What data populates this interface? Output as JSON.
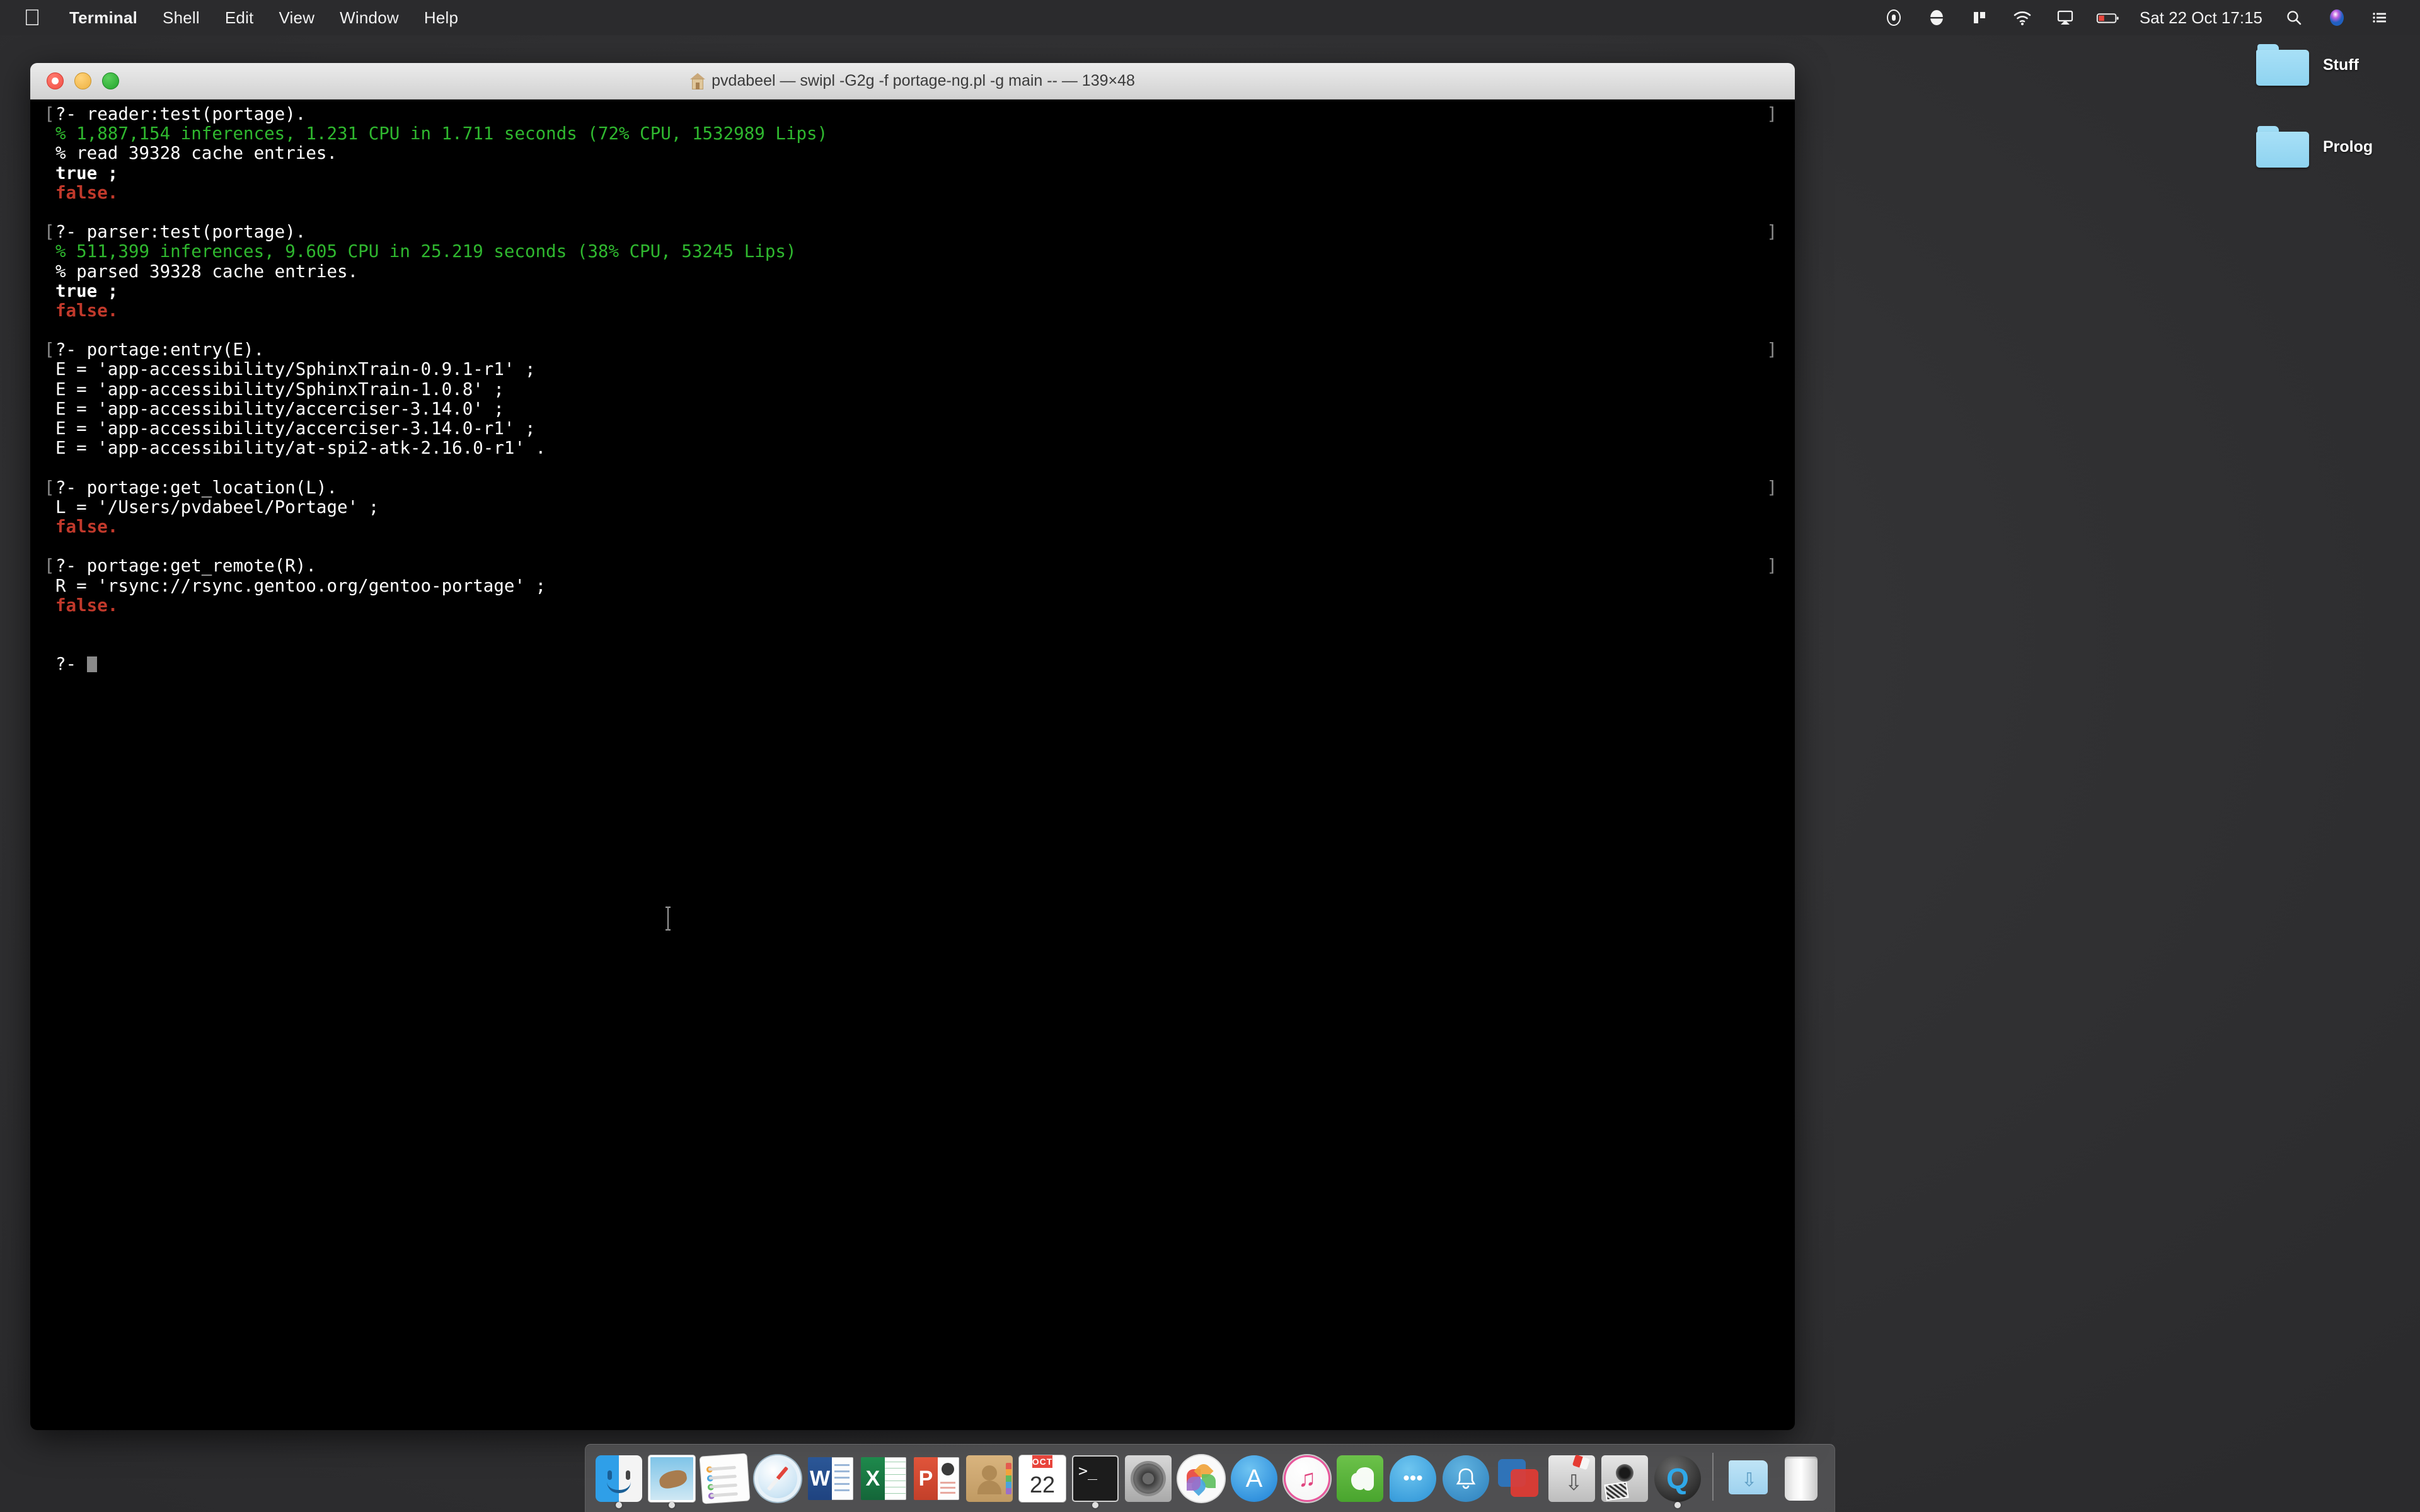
{
  "menubar": {
    "apple_icon": "apple-logo",
    "items": [
      {
        "label": "Terminal",
        "bold": true
      },
      {
        "label": "Shell",
        "bold": false
      },
      {
        "label": "Edit",
        "bold": false
      },
      {
        "label": "View",
        "bold": false
      },
      {
        "label": "Window",
        "bold": false
      },
      {
        "label": "Help",
        "bold": false
      }
    ],
    "status_icons": [
      "screen-recording-icon",
      "display-contrast-icon",
      "split-view-icon",
      "wifi-icon",
      "airplay-icon",
      "battery-low-icon"
    ],
    "clock": "Sat 22 Oct  17:15",
    "search_icon": "search-icon",
    "siri_icon": "siri-icon",
    "control_center_icon": "control-center-icon",
    "battery_color": "#e8453c"
  },
  "desktop": {
    "background_color": "#313133",
    "icons": [
      {
        "name": "Stuff",
        "type": "folder"
      },
      {
        "name": "Prolog",
        "type": "folder"
      }
    ],
    "folder_color": "#8ed3f0"
  },
  "window": {
    "title": "pvdabeel — swipl -G2g -f portage-ng.pl -g main -- — 139×48",
    "home_icon": "home-folder-icon",
    "controls": {
      "close": "close-button",
      "minimize": "minimize-button",
      "zoom": "zoom-button"
    },
    "size_label": "139×48",
    "background_color": "#000000"
  },
  "terminal": {
    "prompt_mark_left": "[",
    "prompt_mark_right": "]",
    "colors": {
      "foreground": "#ffffff",
      "green": "#2fb82f",
      "red": "#c0392b",
      "cursor": "#8a8a8a",
      "mark": "#8a8a8a"
    },
    "lines": [
      {
        "text": "?- reader:test(portage).",
        "style": "white",
        "mark": true
      },
      {
        "text": "% 1,887,154 inferences, 1.231 CPU in 1.711 seconds (72% CPU, 1532989 Lips)",
        "style": "green",
        "mark": false
      },
      {
        "text": "% read 39328 cache entries.",
        "style": "white",
        "mark": false
      },
      {
        "text": "true ;",
        "style": "bold",
        "mark": false
      },
      {
        "text": "false.",
        "style": "red",
        "mark": false
      },
      {
        "text": "",
        "style": "white",
        "mark": false
      },
      {
        "text": "?- parser:test(portage).",
        "style": "white",
        "mark": true
      },
      {
        "text": "% 511,399 inferences, 9.605 CPU in 25.219 seconds (38% CPU, 53245 Lips)",
        "style": "green",
        "mark": false
      },
      {
        "text": "% parsed 39328 cache entries.",
        "style": "white",
        "mark": false
      },
      {
        "text": "true ;",
        "style": "bold",
        "mark": false
      },
      {
        "text": "false.",
        "style": "red",
        "mark": false
      },
      {
        "text": "",
        "style": "white",
        "mark": false
      },
      {
        "text": "?- portage:entry(E).",
        "style": "white",
        "mark": true
      },
      {
        "text": "E = 'app-accessibility/SphinxTrain-0.9.1-r1' ;",
        "style": "white",
        "mark": false
      },
      {
        "text": "E = 'app-accessibility/SphinxTrain-1.0.8' ;",
        "style": "white",
        "mark": false
      },
      {
        "text": "E = 'app-accessibility/accerciser-3.14.0' ;",
        "style": "white",
        "mark": false
      },
      {
        "text": "E = 'app-accessibility/accerciser-3.14.0-r1' ;",
        "style": "white",
        "mark": false
      },
      {
        "text": "E = 'app-accessibility/at-spi2-atk-2.16.0-r1' .",
        "style": "white",
        "mark": false
      },
      {
        "text": "",
        "style": "white",
        "mark": false
      },
      {
        "text": "?- portage:get_location(L).",
        "style": "white",
        "mark": true
      },
      {
        "text": "L = '/Users/pvdabeel/Portage' ;",
        "style": "white",
        "mark": false
      },
      {
        "text": "false.",
        "style": "red",
        "mark": false
      },
      {
        "text": "",
        "style": "white",
        "mark": false
      },
      {
        "text": "?- portage:get_remote(R).",
        "style": "white",
        "mark": true
      },
      {
        "text": "R = 'rsync://rsync.gentoo.org/gentoo-portage' ;",
        "style": "white",
        "mark": false
      },
      {
        "text": "false.",
        "style": "red",
        "mark": false
      },
      {
        "text": "",
        "style": "white",
        "mark": false
      },
      {
        "text": "",
        "style": "white",
        "mark": false
      }
    ],
    "active_prompt": "?- ",
    "mouse_cursor": "i-beam-cursor"
  },
  "dock": {
    "items": [
      {
        "name": "Finder",
        "icon": "finder-icon",
        "running": true
      },
      {
        "name": "Mail",
        "icon": "mail-icon",
        "running": true
      },
      {
        "name": "Notes",
        "icon": "notes-icon",
        "running": false
      },
      {
        "name": "Safari",
        "icon": "safari-icon",
        "running": false
      },
      {
        "name": "Microsoft Word",
        "icon": "word-icon",
        "running": false,
        "glyph": "W"
      },
      {
        "name": "Microsoft Excel",
        "icon": "excel-icon",
        "running": false,
        "glyph": "X"
      },
      {
        "name": "Microsoft PowerPoint",
        "icon": "powerpoint-icon",
        "running": false,
        "glyph": "P"
      },
      {
        "name": "Contacts",
        "icon": "contacts-icon",
        "running": false
      },
      {
        "name": "Calendar",
        "icon": "calendar-icon",
        "running": false,
        "month": "OCT",
        "day": "22"
      },
      {
        "name": "Terminal",
        "icon": "terminal-icon",
        "running": true,
        "glyph": ">_"
      },
      {
        "name": "System Preferences",
        "icon": "system-preferences-icon",
        "running": false
      },
      {
        "name": "Photos",
        "icon": "photos-icon",
        "running": false
      },
      {
        "name": "App Store",
        "icon": "app-store-icon",
        "running": false,
        "glyph": "A"
      },
      {
        "name": "iTunes",
        "icon": "itunes-icon",
        "running": false,
        "glyph": "♫"
      },
      {
        "name": "Evernote",
        "icon": "evernote-icon",
        "running": false,
        "glyph": "🐘"
      },
      {
        "name": "Messages",
        "icon": "messages-icon",
        "running": false,
        "glyph": "•••"
      },
      {
        "name": "Notifications",
        "icon": "bell-icon",
        "running": false,
        "glyph": "🔔"
      },
      {
        "name": "VMware Fusion",
        "icon": "vmware-icon",
        "running": false
      },
      {
        "name": "ScreenFlow",
        "icon": "screenflow-icon",
        "running": false
      },
      {
        "name": "iPhoto",
        "icon": "iphoto-icon",
        "running": false
      },
      {
        "name": "QuickTime Player",
        "icon": "quicktime-icon",
        "running": true,
        "glyph": "Q"
      },
      {
        "name": "separator",
        "icon": "dock-separator",
        "running": false
      },
      {
        "name": "Downloads",
        "icon": "downloads-folder-icon",
        "running": false
      },
      {
        "name": "Trash",
        "icon": "trash-icon",
        "running": false
      }
    ]
  }
}
